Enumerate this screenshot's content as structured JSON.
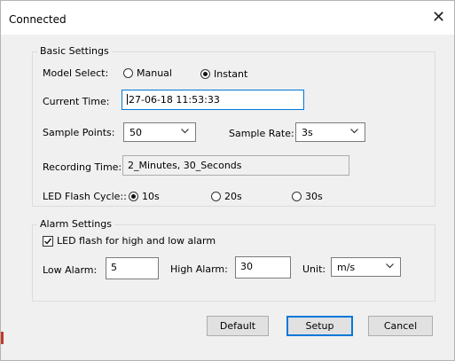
{
  "window": {
    "title": "Connected"
  },
  "basic": {
    "legend": "Basic Settings",
    "model_select_label": "Model Select:",
    "manual_label": "Manual",
    "instant_label": "Instant",
    "current_time_label": "Current Time:",
    "current_time_value": "27-06-18 11:53:33",
    "sample_points_label": "Sample Points:",
    "sample_points_value": "50",
    "sample_rate_label": "Sample Rate:",
    "sample_rate_value": "3s",
    "recording_time_label": "Recording Time:",
    "recording_time_value": "2_Minutes, 30_Seconds",
    "led_flash_label": "LED Flash Cycle::",
    "led_10s": "10s",
    "led_20s": "20s",
    "led_30s": "30s"
  },
  "alarm": {
    "legend": "Alarm Settings",
    "led_alarm_label": "LED flash for high and low alarm",
    "low_label": "Low Alarm:",
    "low_value": "5",
    "high_label": "High Alarm:",
    "high_value": "30",
    "unit_label": "Unit:",
    "unit_value": "m/s"
  },
  "buttons": {
    "default": "Default",
    "setup": "Setup",
    "cancel": "Cancel"
  }
}
